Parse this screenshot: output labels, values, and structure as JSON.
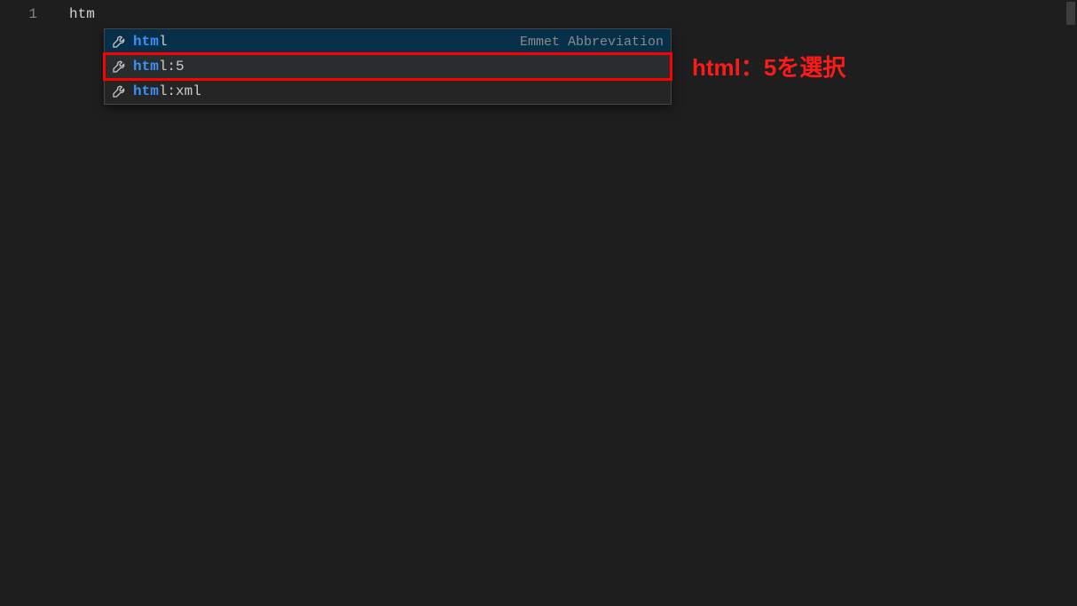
{
  "editor": {
    "line_number": "1",
    "typed_text": "htm"
  },
  "suggest": {
    "detail_label": "Emmet Abbreviation",
    "items": [
      {
        "match": "htm",
        "rest": "l",
        "selected": true,
        "boxed": false,
        "show_detail": true
      },
      {
        "match": "htm",
        "rest": "l:5",
        "selected": false,
        "boxed": true,
        "show_detail": false
      },
      {
        "match": "htm",
        "rest": "l:xml",
        "selected": false,
        "boxed": false,
        "show_detail": false
      }
    ]
  },
  "annotation": {
    "text": "html：5を選択"
  },
  "icons": {
    "wrench": "wrench-icon"
  },
  "colors": {
    "highlight_box": "#ff0000",
    "annotation_text": "#ff1a1a",
    "match_text": "#3794ff"
  }
}
